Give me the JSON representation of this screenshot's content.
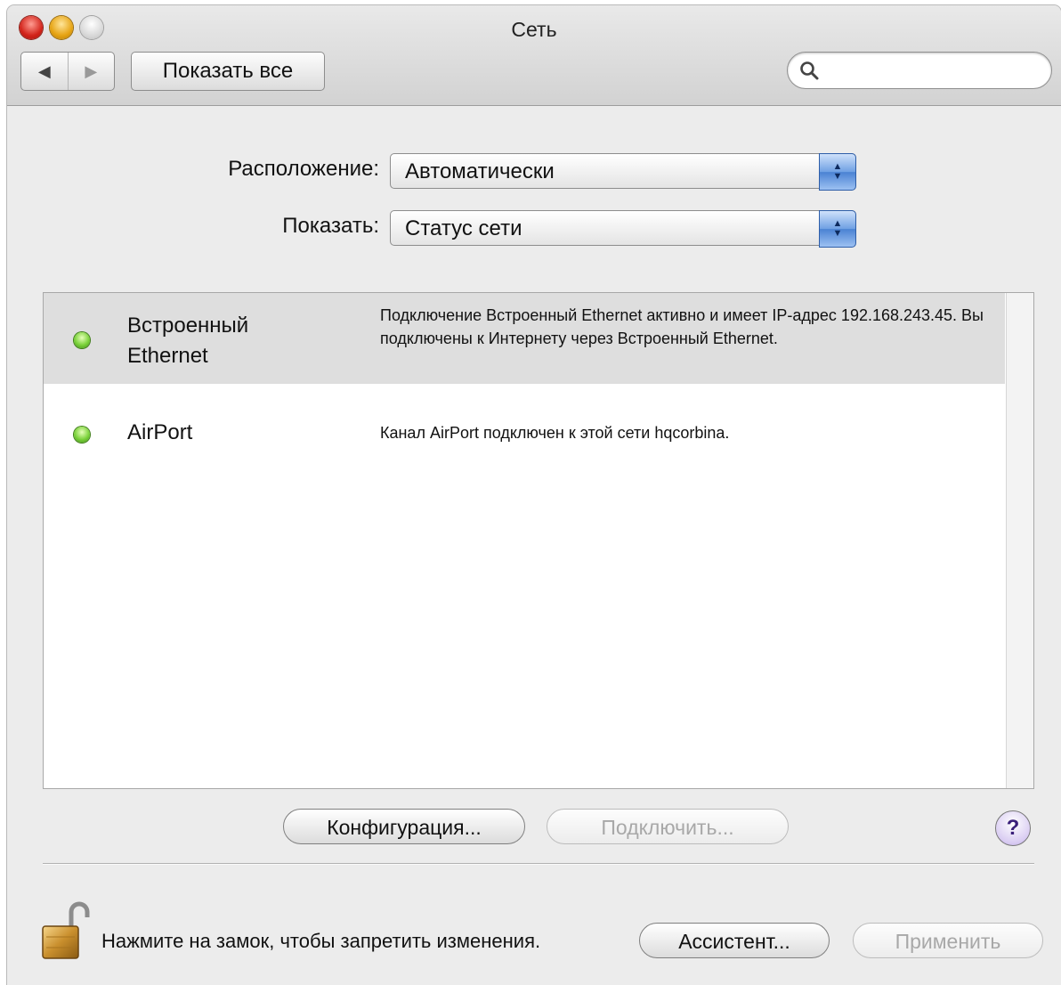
{
  "window": {
    "title": "Сеть"
  },
  "toolbar": {
    "show_all_label": "Показать все",
    "search_placeholder": ""
  },
  "location": {
    "label": "Расположение:",
    "value": "Автоматически"
  },
  "show": {
    "label": "Показать:",
    "value": "Статус сети"
  },
  "services": [
    {
      "name": "Встроенный Ethernet",
      "status": "green",
      "description": "Подключение Встроенный Ethernet активно и имеет IP-адрес 192.168.243.45. Вы подключены к Интернету через Встроенный Ethernet."
    },
    {
      "name": "AirPort",
      "status": "green",
      "description": "Канал AirPort подключен к этой сети hqcorbina."
    }
  ],
  "buttons": {
    "configure": "Конфигурация...",
    "connect": "Подключить...",
    "help": "?",
    "assistant": "Ассистент...",
    "apply": "Применить"
  },
  "lock": {
    "text": "Нажмите на замок, чтобы запретить изменения."
  },
  "colors": {
    "status_green": "#6cc932",
    "selection_gray": "#dedede",
    "select_arrows_blue": "#4a82d3"
  }
}
